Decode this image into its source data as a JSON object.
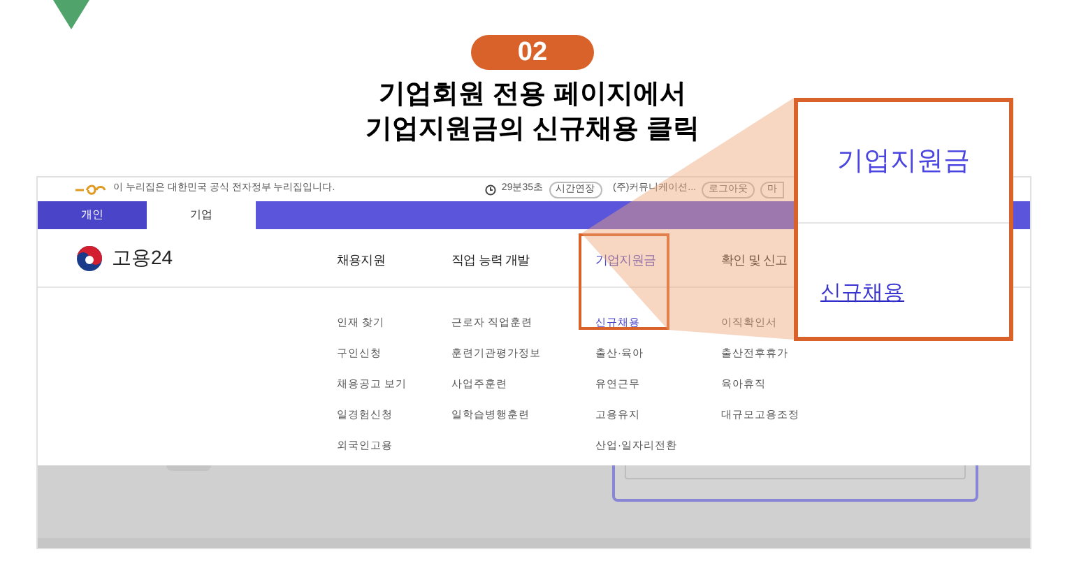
{
  "step": {
    "badge": "02",
    "title_lines": [
      "기업회원 전용 페이지에서",
      "기업지원금의 신규채용 클릭"
    ]
  },
  "top_bar": {
    "notice": "이 누리집은 대한민국 공식 전자정부 누리집입니다.",
    "timer": "29분35초",
    "extend": "시간연장",
    "company": "(주)커뮤니케이션...",
    "logout": "로그아웃",
    "mypage": "마"
  },
  "user_tabs": [
    {
      "label": "개인",
      "selected": false
    },
    {
      "label": "기업",
      "selected": true
    }
  ],
  "site_logo": "고용24",
  "menu": [
    {
      "label": "채용지원",
      "selected": false,
      "items": [
        {
          "label": "인재 찾기",
          "selected": false
        },
        {
          "label": "구인신청",
          "selected": false
        },
        {
          "label": "채용공고 보기",
          "selected": false
        },
        {
          "label": "일경험신청",
          "selected": false
        },
        {
          "label": "외국인고용",
          "selected": false
        }
      ]
    },
    {
      "label": "직업 능력 개발",
      "selected": false,
      "items": [
        {
          "label": "근로자 직업훈련",
          "selected": false
        },
        {
          "label": "훈련기관평가정보",
          "selected": false
        },
        {
          "label": "사업주훈련",
          "selected": false
        },
        {
          "label": "일학습병행훈련",
          "selected": false
        }
      ]
    },
    {
      "label": "기업지원금",
      "selected": true,
      "items": [
        {
          "label": "신규채용",
          "selected": true
        },
        {
          "label": "출산·육아",
          "selected": false
        },
        {
          "label": "유연근무",
          "selected": false
        },
        {
          "label": "고용유지",
          "selected": false
        },
        {
          "label": "산업·일자리전환",
          "selected": false
        }
      ]
    },
    {
      "label": "확인 및 신고",
      "selected": false,
      "items": [
        {
          "label": "이직확인서",
          "selected": false
        },
        {
          "label": "출산전후휴가",
          "selected": false
        },
        {
          "label": "육아휴직",
          "selected": false
        },
        {
          "label": "대규모고용조정",
          "selected": false
        }
      ]
    }
  ],
  "callout": {
    "heading": "기업지원금",
    "link": "신규채용"
  }
}
